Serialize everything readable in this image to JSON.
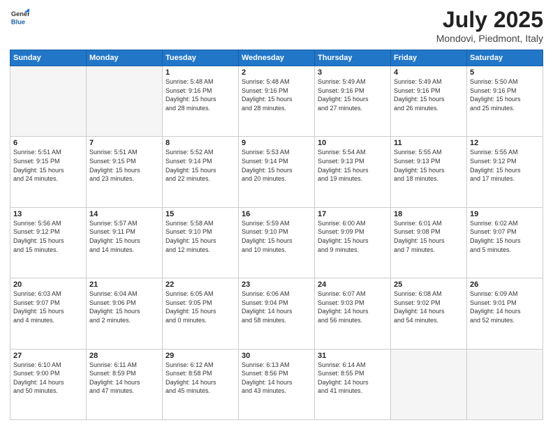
{
  "header": {
    "logo": {
      "general": "General",
      "blue": "Blue"
    },
    "title": "July 2025",
    "location": "Mondovi, Piedmont, Italy"
  },
  "days_of_week": [
    "Sunday",
    "Monday",
    "Tuesday",
    "Wednesday",
    "Thursday",
    "Friday",
    "Saturday"
  ],
  "weeks": [
    [
      {
        "day": "",
        "info": ""
      },
      {
        "day": "",
        "info": ""
      },
      {
        "day": "1",
        "info": "Sunrise: 5:48 AM\nSunset: 9:16 PM\nDaylight: 15 hours\nand 28 minutes."
      },
      {
        "day": "2",
        "info": "Sunrise: 5:48 AM\nSunset: 9:16 PM\nDaylight: 15 hours\nand 28 minutes."
      },
      {
        "day": "3",
        "info": "Sunrise: 5:49 AM\nSunset: 9:16 PM\nDaylight: 15 hours\nand 27 minutes."
      },
      {
        "day": "4",
        "info": "Sunrise: 5:49 AM\nSunset: 9:16 PM\nDaylight: 15 hours\nand 26 minutes."
      },
      {
        "day": "5",
        "info": "Sunrise: 5:50 AM\nSunset: 9:16 PM\nDaylight: 15 hours\nand 25 minutes."
      }
    ],
    [
      {
        "day": "6",
        "info": "Sunrise: 5:51 AM\nSunset: 9:15 PM\nDaylight: 15 hours\nand 24 minutes."
      },
      {
        "day": "7",
        "info": "Sunrise: 5:51 AM\nSunset: 9:15 PM\nDaylight: 15 hours\nand 23 minutes."
      },
      {
        "day": "8",
        "info": "Sunrise: 5:52 AM\nSunset: 9:14 PM\nDaylight: 15 hours\nand 22 minutes."
      },
      {
        "day": "9",
        "info": "Sunrise: 5:53 AM\nSunset: 9:14 PM\nDaylight: 15 hours\nand 20 minutes."
      },
      {
        "day": "10",
        "info": "Sunrise: 5:54 AM\nSunset: 9:13 PM\nDaylight: 15 hours\nand 19 minutes."
      },
      {
        "day": "11",
        "info": "Sunrise: 5:55 AM\nSunset: 9:13 PM\nDaylight: 15 hours\nand 18 minutes."
      },
      {
        "day": "12",
        "info": "Sunrise: 5:55 AM\nSunset: 9:12 PM\nDaylight: 15 hours\nand 17 minutes."
      }
    ],
    [
      {
        "day": "13",
        "info": "Sunrise: 5:56 AM\nSunset: 9:12 PM\nDaylight: 15 hours\nand 15 minutes."
      },
      {
        "day": "14",
        "info": "Sunrise: 5:57 AM\nSunset: 9:11 PM\nDaylight: 15 hours\nand 14 minutes."
      },
      {
        "day": "15",
        "info": "Sunrise: 5:58 AM\nSunset: 9:10 PM\nDaylight: 15 hours\nand 12 minutes."
      },
      {
        "day": "16",
        "info": "Sunrise: 5:59 AM\nSunset: 9:10 PM\nDaylight: 15 hours\nand 10 minutes."
      },
      {
        "day": "17",
        "info": "Sunrise: 6:00 AM\nSunset: 9:09 PM\nDaylight: 15 hours\nand 9 minutes."
      },
      {
        "day": "18",
        "info": "Sunrise: 6:01 AM\nSunset: 9:08 PM\nDaylight: 15 hours\nand 7 minutes."
      },
      {
        "day": "19",
        "info": "Sunrise: 6:02 AM\nSunset: 9:07 PM\nDaylight: 15 hours\nand 5 minutes."
      }
    ],
    [
      {
        "day": "20",
        "info": "Sunrise: 6:03 AM\nSunset: 9:07 PM\nDaylight: 15 hours\nand 4 minutes."
      },
      {
        "day": "21",
        "info": "Sunrise: 6:04 AM\nSunset: 9:06 PM\nDaylight: 15 hours\nand 2 minutes."
      },
      {
        "day": "22",
        "info": "Sunrise: 6:05 AM\nSunset: 9:05 PM\nDaylight: 15 hours\nand 0 minutes."
      },
      {
        "day": "23",
        "info": "Sunrise: 6:06 AM\nSunset: 9:04 PM\nDaylight: 14 hours\nand 58 minutes."
      },
      {
        "day": "24",
        "info": "Sunrise: 6:07 AM\nSunset: 9:03 PM\nDaylight: 14 hours\nand 56 minutes."
      },
      {
        "day": "25",
        "info": "Sunrise: 6:08 AM\nSunset: 9:02 PM\nDaylight: 14 hours\nand 54 minutes."
      },
      {
        "day": "26",
        "info": "Sunrise: 6:09 AM\nSunset: 9:01 PM\nDaylight: 14 hours\nand 52 minutes."
      }
    ],
    [
      {
        "day": "27",
        "info": "Sunrise: 6:10 AM\nSunset: 9:00 PM\nDaylight: 14 hours\nand 50 minutes."
      },
      {
        "day": "28",
        "info": "Sunrise: 6:11 AM\nSunset: 8:59 PM\nDaylight: 14 hours\nand 47 minutes."
      },
      {
        "day": "29",
        "info": "Sunrise: 6:12 AM\nSunset: 8:58 PM\nDaylight: 14 hours\nand 45 minutes."
      },
      {
        "day": "30",
        "info": "Sunrise: 6:13 AM\nSunset: 8:56 PM\nDaylight: 14 hours\nand 43 minutes."
      },
      {
        "day": "31",
        "info": "Sunrise: 6:14 AM\nSunset: 8:55 PM\nDaylight: 14 hours\nand 41 minutes."
      },
      {
        "day": "",
        "info": ""
      },
      {
        "day": "",
        "info": ""
      }
    ]
  ]
}
